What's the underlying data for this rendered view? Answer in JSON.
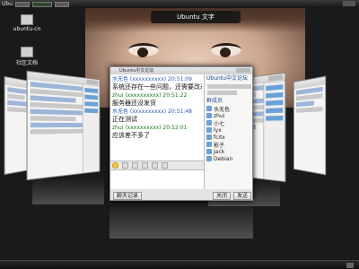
{
  "panel": {
    "app_label": "Ubu"
  },
  "scale_title": "Ubuntu 文字",
  "desktop_icons": [
    {
      "label": "ubuntu-cn"
    },
    {
      "label": "社区文档"
    }
  ],
  "main_window": {
    "title": "Ubuntu中文论坛",
    "messages": [
      {
        "sender": "水无色 (xxxxxxxxxx) 20:51:09",
        "text": "系统还存在一些问题，还需要改进",
        "me": false
      },
      {
        "sender": "zhui (xxxxxxxxxx) 20:51:22",
        "text": "服务器还没发货",
        "me": true
      },
      {
        "sender": "水无色 (xxxxxxxxxx) 20:51:48",
        "text": "正在测试",
        "me": false
      },
      {
        "sender": "zhui (xxxxxxxxxx) 20:52:01",
        "text": "应该差不多了",
        "me": true
      }
    ],
    "send_button": "发送",
    "close_button": "关闭",
    "record_button": "聊天记录",
    "side_panel": {
      "header": "Ubuntu中文论坛",
      "members_header": "群成员",
      "members": [
        "水无色",
        "zhui",
        "小七",
        "lyx",
        "fcitx",
        "影子",
        "Jack",
        "Debian"
      ]
    }
  },
  "colors": {
    "accent": "#2a5db0",
    "me": "#1a7a1a"
  }
}
